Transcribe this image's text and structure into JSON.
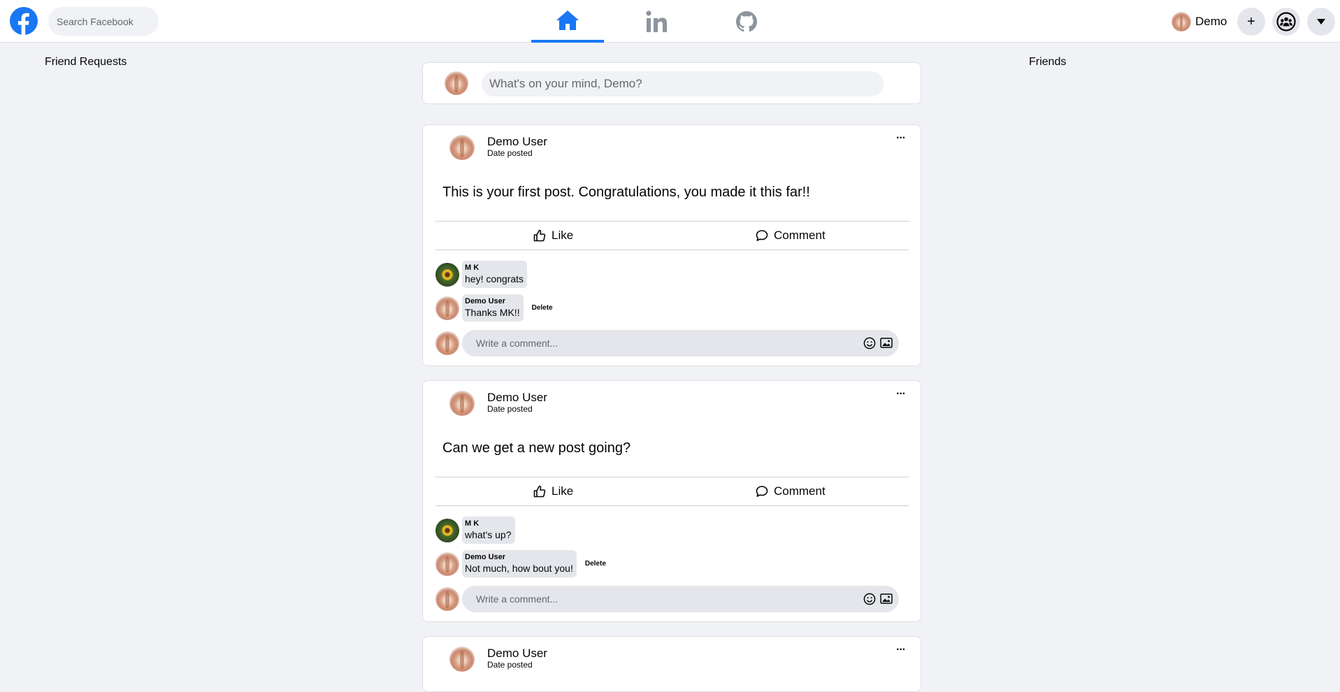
{
  "header": {
    "logo_icon": "facebook-f-icon",
    "search_placeholder": "Search Facebook",
    "nav_tabs": [
      {
        "icon": "home-icon",
        "active": true
      },
      {
        "icon": "linkedin-icon",
        "active": false
      },
      {
        "icon": "github-icon",
        "active": false
      }
    ],
    "profile_name": "Demo",
    "create_label": "+",
    "groups_icon": "groups-icon",
    "menu_icon": "caret-down-icon",
    "accent_color": "#1877f2"
  },
  "left_sidebar": {
    "title": "Friend Requests"
  },
  "right_sidebar": {
    "title": "Friends"
  },
  "composer": {
    "placeholder": "What's on your mind, Demo?"
  },
  "posts": [
    {
      "author": "Demo User",
      "date": "Date posted",
      "more_label": "···",
      "body": "This is your first post. Congratulations, you made it this far!!",
      "like_label": "Like",
      "comment_label": "Comment",
      "comments": [
        {
          "author": "M K",
          "text": "hey! congrats",
          "avatar": "sunflower",
          "delete_label": ""
        },
        {
          "author": "Demo User",
          "text": "Thanks MK!!",
          "avatar": "demo",
          "delete_label": "Delete"
        }
      ],
      "write_placeholder": "Write a comment..."
    },
    {
      "author": "Demo User",
      "date": "Date posted",
      "more_label": "···",
      "body": "Can we get a new post going?",
      "like_label": "Like",
      "comment_label": "Comment",
      "comments": [
        {
          "author": "M K",
          "text": "what's up?",
          "avatar": "sunflower",
          "delete_label": ""
        },
        {
          "author": "Demo User",
          "text": "Not much, how bout you!",
          "avatar": "demo",
          "delete_label": "Delete"
        }
      ],
      "write_placeholder": "Write a comment..."
    },
    {
      "author": "Demo User",
      "date": "Date posted",
      "more_label": "···"
    }
  ]
}
